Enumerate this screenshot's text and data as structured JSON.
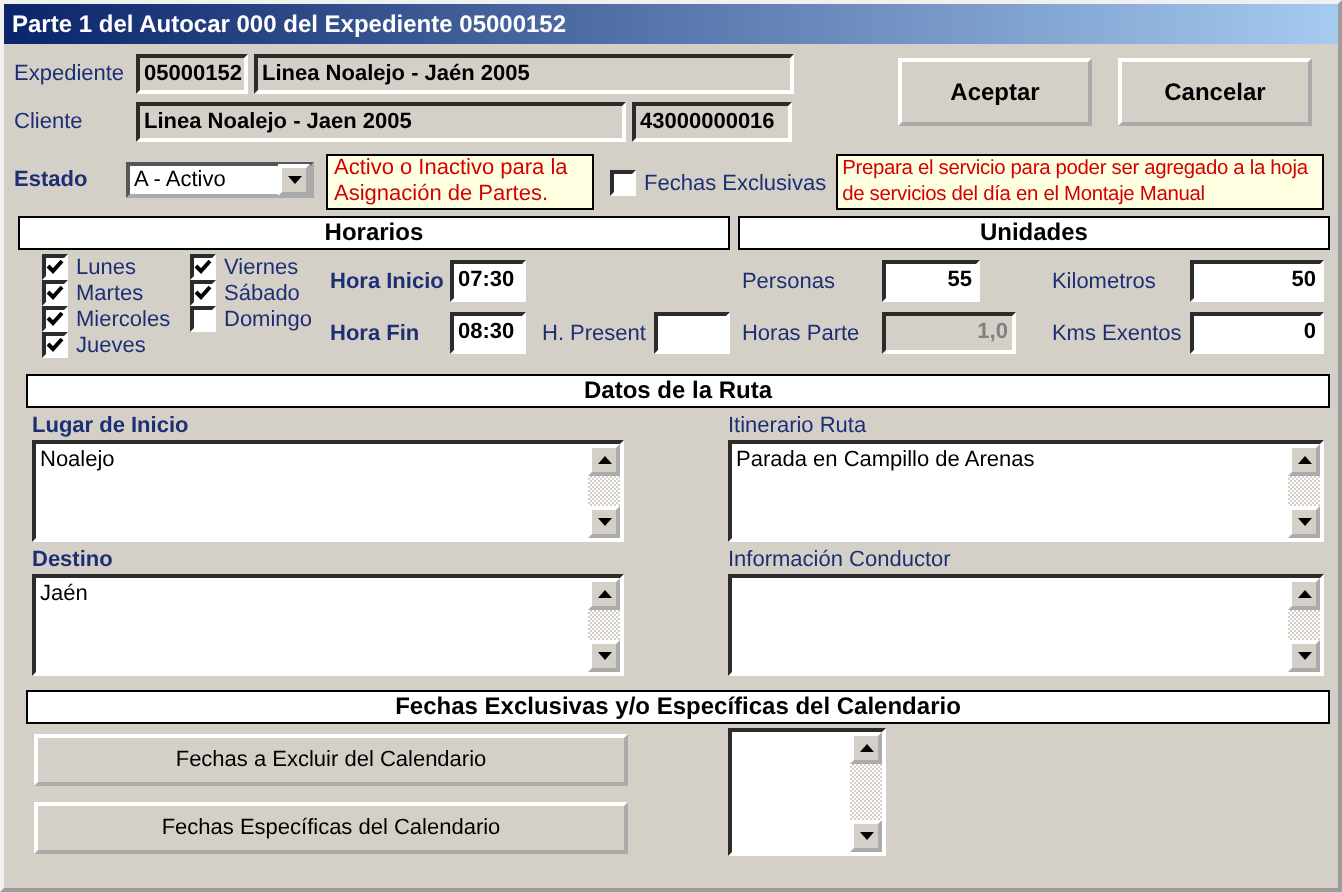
{
  "window": {
    "title": "Parte 1 del Autocar 000 del Expediente 05000152"
  },
  "expediente": {
    "label": "Expediente",
    "code": "05000152",
    "name": "Linea Noalejo - Jaén 2005"
  },
  "cliente": {
    "label": "Cliente",
    "name": "Linea Noalejo - Jaen 2005",
    "code": "43000000016"
  },
  "buttons": [
    {
      "label": "Aceptar"
    },
    {
      "label": "Cancelar"
    }
  ],
  "estado": {
    "label": "Estado",
    "value": "A - Activo",
    "note": "Activo o Inactivo para la Asignación de Partes."
  },
  "fechas_exclusivas": {
    "label": "Fechas Exclusivas",
    "checked": false,
    "note": "Prepara el servicio para poder ser agregado a la hoja de servicios del día en el Montaje Manual"
  },
  "horarios": {
    "title": "Horarios",
    "days": [
      {
        "label": "Lunes",
        "checked": true
      },
      {
        "label": "Martes",
        "checked": true
      },
      {
        "label": "Miercoles",
        "checked": true
      },
      {
        "label": "Jueves",
        "checked": true
      },
      {
        "label": "Viernes",
        "checked": true
      },
      {
        "label": "Sábado",
        "checked": true
      },
      {
        "label": "Domingo",
        "checked": false
      }
    ],
    "hora_inicio": {
      "label": "Hora Inicio",
      "value": "07:30"
    },
    "hora_fin": {
      "label": "Hora Fin",
      "value": "08:30"
    },
    "h_present": {
      "label": "H. Present"
    }
  },
  "unidades": {
    "title": "Unidades",
    "fields": [
      {
        "label": "Personas",
        "value": "55",
        "disabled": false
      },
      {
        "label": "Kilometros",
        "value": "50",
        "disabled": false
      },
      {
        "label": "Horas Parte",
        "value": "1,0",
        "disabled": true
      },
      {
        "label": "Kms Exentos",
        "value": "0",
        "disabled": false
      }
    ]
  },
  "ruta": {
    "title": "Datos de la Ruta",
    "fields": [
      {
        "label": "Lugar de Inicio",
        "kind": "primary",
        "value": "Noalejo"
      },
      {
        "label": "Itinerario Ruta",
        "kind": "secondary",
        "value": "Parada en Campillo de Arenas"
      },
      {
        "label": "Destino",
        "kind": "primary",
        "value": "Jaén"
      },
      {
        "label": "Información Conductor",
        "kind": "secondary"
      }
    ]
  },
  "calendario": {
    "title": "Fechas Exclusivas y/o Específicas del Calendario",
    "buttons": [
      {
        "label": "Fechas a Excluir del Calendario"
      },
      {
        "label": "Fechas Específicas del Calendario"
      }
    ]
  }
}
